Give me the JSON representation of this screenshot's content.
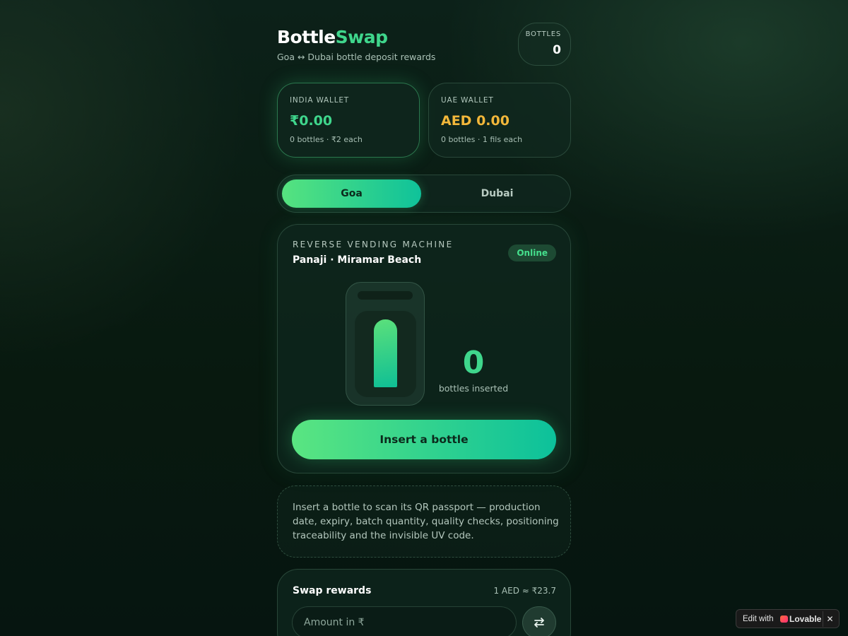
{
  "header": {
    "brand_part1": "Bottle",
    "brand_part2": "Swap",
    "tagline": "Goa ↔ Dubai bottle deposit rewards",
    "counter_label": "BOTTLES",
    "counter_value": "0"
  },
  "wallets": {
    "india": {
      "label": "INDIA WALLET",
      "amount": "₹0.00",
      "detail": "0 bottles · ₹2 each"
    },
    "uae": {
      "label": "UAE WALLET",
      "amount": "AED 0.00",
      "detail": "0 bottles · 1 fils each"
    }
  },
  "location_toggle": {
    "options": [
      {
        "label": "Goa",
        "selected": true
      },
      {
        "label": "Dubai",
        "selected": false
      }
    ]
  },
  "machine": {
    "eyebrow": "REVERSE VENDING MACHINE",
    "location": "Panaji · Miramar Beach",
    "status": "Online",
    "count": "0",
    "count_label": "bottles inserted",
    "button_label": "Insert a bottle"
  },
  "info": {
    "text": "Insert a bottle to scan its QR passport — production date, expiry, batch quantity, quality checks, positioning traceability and the invisible UV code."
  },
  "swap": {
    "title": "Swap rewards",
    "rate": "1 AED ≈ ₹23.7",
    "input_placeholder": "Amount in ₹",
    "swap_icon": "swap-arrows-icon"
  },
  "badge": {
    "prefix": "Edit with",
    "brand": "Lovable",
    "close": "✕"
  },
  "colors": {
    "accent_green": "#3fd68c",
    "accent_gold": "#f2b73a",
    "background": "#08190f"
  }
}
